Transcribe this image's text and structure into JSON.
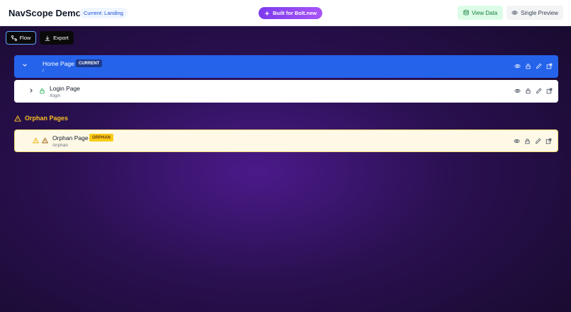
{
  "header": {
    "title": "NavScope Demo",
    "current_badge": "Current: Landing",
    "bolt_label": "Built for Bolt.new",
    "view_data_label": "View Data",
    "single_preview_label": "Single Preview"
  },
  "toolbar": {
    "flow_label": "Flow",
    "export_label": "Export"
  },
  "pages": [
    {
      "name": "Home Page",
      "path": "/",
      "tag": "CURRENT"
    },
    {
      "name": "Login Page",
      "path": "/login"
    }
  ],
  "orphans": {
    "heading": "Orphan Pages",
    "items": [
      {
        "name": "Orphan Page",
        "path": "/orphan",
        "tag": "ORPHAN"
      }
    ]
  },
  "colors": {
    "accent_blue": "#2563eb",
    "bolt_purple": "#7c3aed",
    "warning_yellow": "#fbbf24",
    "success_green": "#15803d"
  },
  "icons": [
    "chevron-down-icon",
    "chevron-right-icon",
    "lock-icon",
    "warning-icon",
    "eye-icon",
    "edit-icon",
    "external-link-icon",
    "sparkle-icon",
    "database-icon",
    "flow-icon",
    "download-icon"
  ]
}
